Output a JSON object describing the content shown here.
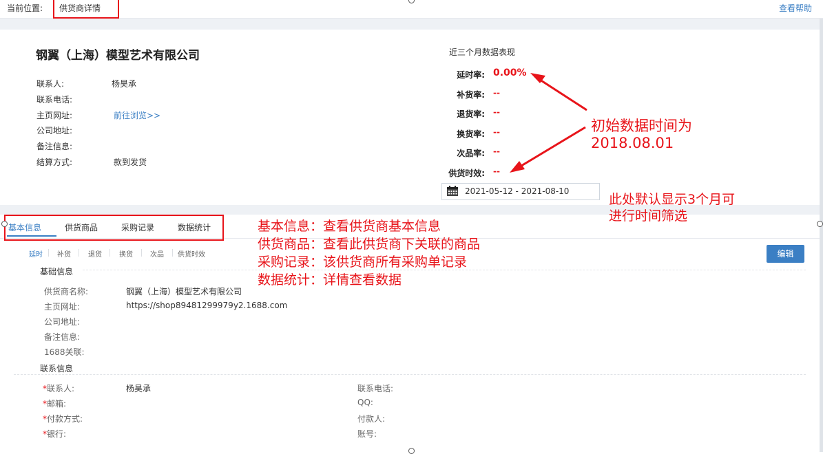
{
  "breadcrumb": {
    "label": "当前位置:",
    "current": "供货商详情"
  },
  "help_link": "查看帮助",
  "company": {
    "name": "钢翼（上海）模型艺术有限公司"
  },
  "contact_info": [
    {
      "label": "联系人:",
      "value": "杨昊承"
    },
    {
      "label": "联系电话:",
      "value": ""
    },
    {
      "label": "主页网址:",
      "value": "前往浏览>>"
    },
    {
      "label": "公司地址:",
      "value": ""
    },
    {
      "label": "备注信息:",
      "value": ""
    },
    {
      "label": "结算方式:",
      "value": "款到发货"
    }
  ],
  "performance": {
    "title": "近三个月数据表现",
    "metrics": [
      {
        "label": "延时率:",
        "value": "0.00%"
      },
      {
        "label": "补货率:",
        "value": "--"
      },
      {
        "label": "退货率:",
        "value": "--"
      },
      {
        "label": "换货率:",
        "value": "--"
      },
      {
        "label": "次品率:",
        "value": "--"
      },
      {
        "label": "供货时效:",
        "value": "--"
      }
    ],
    "date_range": "2021-05-12 - 2021-08-10"
  },
  "tabs": [
    "基本信息",
    "供货商品",
    "采购记录",
    "数据统计"
  ],
  "sub_tabs": [
    "延时",
    "补货",
    "退货",
    "换货",
    "次品",
    "供货时效"
  ],
  "edit_button": "编辑",
  "basic_section": {
    "title": "基础信息",
    "fields": [
      {
        "label": "供货商名称:",
        "value": "钢翼（上海）模型艺术有限公司"
      },
      {
        "label": "主页网址:",
        "value": "https://shop89481299979y2.1688.com"
      },
      {
        "label": "公司地址:",
        "value": ""
      },
      {
        "label": "备注信息:",
        "value": ""
      },
      {
        "label": "1688关联:",
        "value": ""
      }
    ]
  },
  "contact_section": {
    "title": "联系信息",
    "left_fields": [
      {
        "required": "*",
        "label": "联系人:",
        "value": "杨昊承"
      },
      {
        "required": "*",
        "label": "邮箱:",
        "value": ""
      },
      {
        "required": "*",
        "label": "付款方式:",
        "value": ""
      },
      {
        "required": "*",
        "label": "银行:",
        "value": ""
      }
    ],
    "right_fields": [
      {
        "label": "联系电话:",
        "value": ""
      },
      {
        "label": "QQ:",
        "value": ""
      },
      {
        "label": "付款人:",
        "value": ""
      },
      {
        "label": "账号:",
        "value": ""
      }
    ]
  },
  "annotations": {
    "initial_time": [
      "初始数据时间为",
      "2018.08.01"
    ],
    "default_range": [
      "此处默认显示3个月可",
      "进行时间筛选"
    ],
    "tab_notes": [
      "基本信息：查看供货商基本信息",
      "供货商品：查看此供货商下关联的商品",
      "采购记录：该供货商所有采购单记录",
      "数据统计：详情查看数据"
    ]
  },
  "colors": {
    "accent": "#3b7fc4",
    "annotation": "#e8141a",
    "band": "#eef1f5"
  }
}
